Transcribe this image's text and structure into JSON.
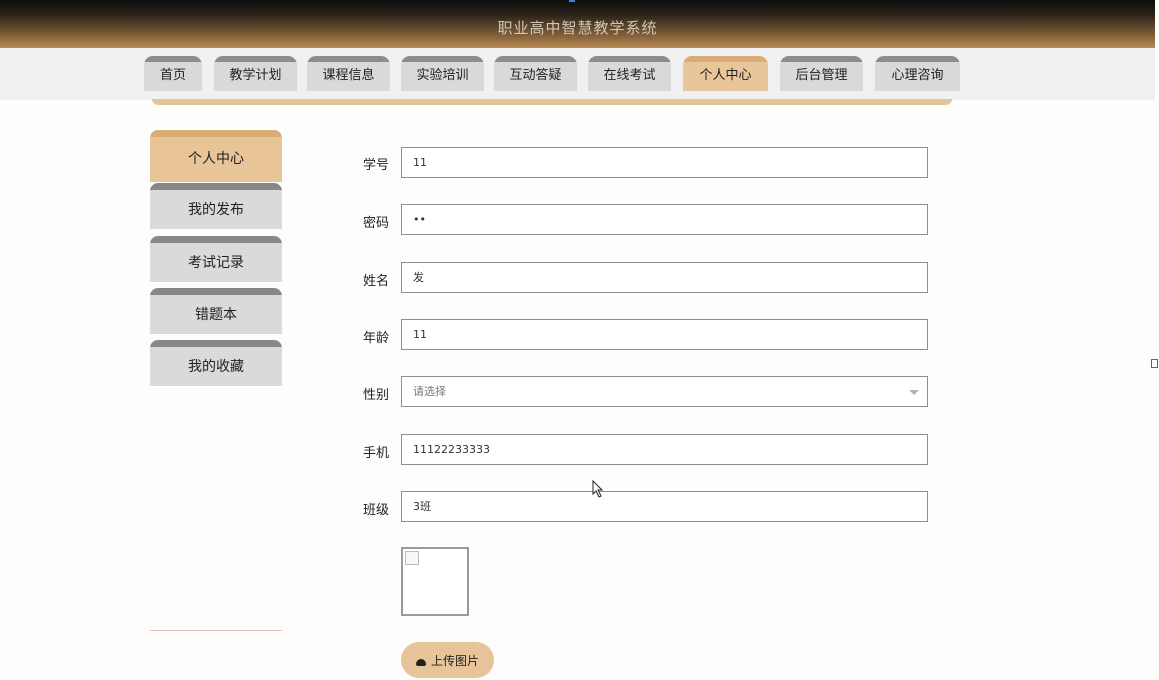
{
  "header": {
    "title": "职业高中智慧教学系统"
  },
  "nav": {
    "items": [
      {
        "label": "首页"
      },
      {
        "label": "教学计划"
      },
      {
        "label": "课程信息"
      },
      {
        "label": "实验培训"
      },
      {
        "label": "互动答疑"
      },
      {
        "label": "在线考试"
      },
      {
        "label": "个人中心",
        "active": true
      },
      {
        "label": "后台管理"
      },
      {
        "label": "心理咨询"
      }
    ]
  },
  "sidebar": {
    "items": [
      {
        "label": "个人中心",
        "active": true
      },
      {
        "label": "我的发布"
      },
      {
        "label": "考试记录"
      },
      {
        "label": "错题本"
      },
      {
        "label": "我的收藏"
      }
    ]
  },
  "form": {
    "xuehao": {
      "label": "学号",
      "value": "11"
    },
    "mima": {
      "label": "密码",
      "value": "••"
    },
    "xingming": {
      "label": "姓名",
      "value": "发"
    },
    "nianling": {
      "label": "年龄",
      "value": "11"
    },
    "xingbie": {
      "label": "性别",
      "placeholder": "请选择"
    },
    "shouji": {
      "label": "手机",
      "value": "11122233333"
    },
    "banji": {
      "label": "班级",
      "value": "3班"
    }
  },
  "upload": {
    "label": "上传图片"
  },
  "colors": {
    "accent": "#e7c49a",
    "accent_dark": "#d8ad74",
    "header_brown": "#b98a53",
    "inactive_tab": "#d9d9d9"
  },
  "icons": {
    "upload": "cloud-upload-icon",
    "select": "chevron-down-icon"
  }
}
